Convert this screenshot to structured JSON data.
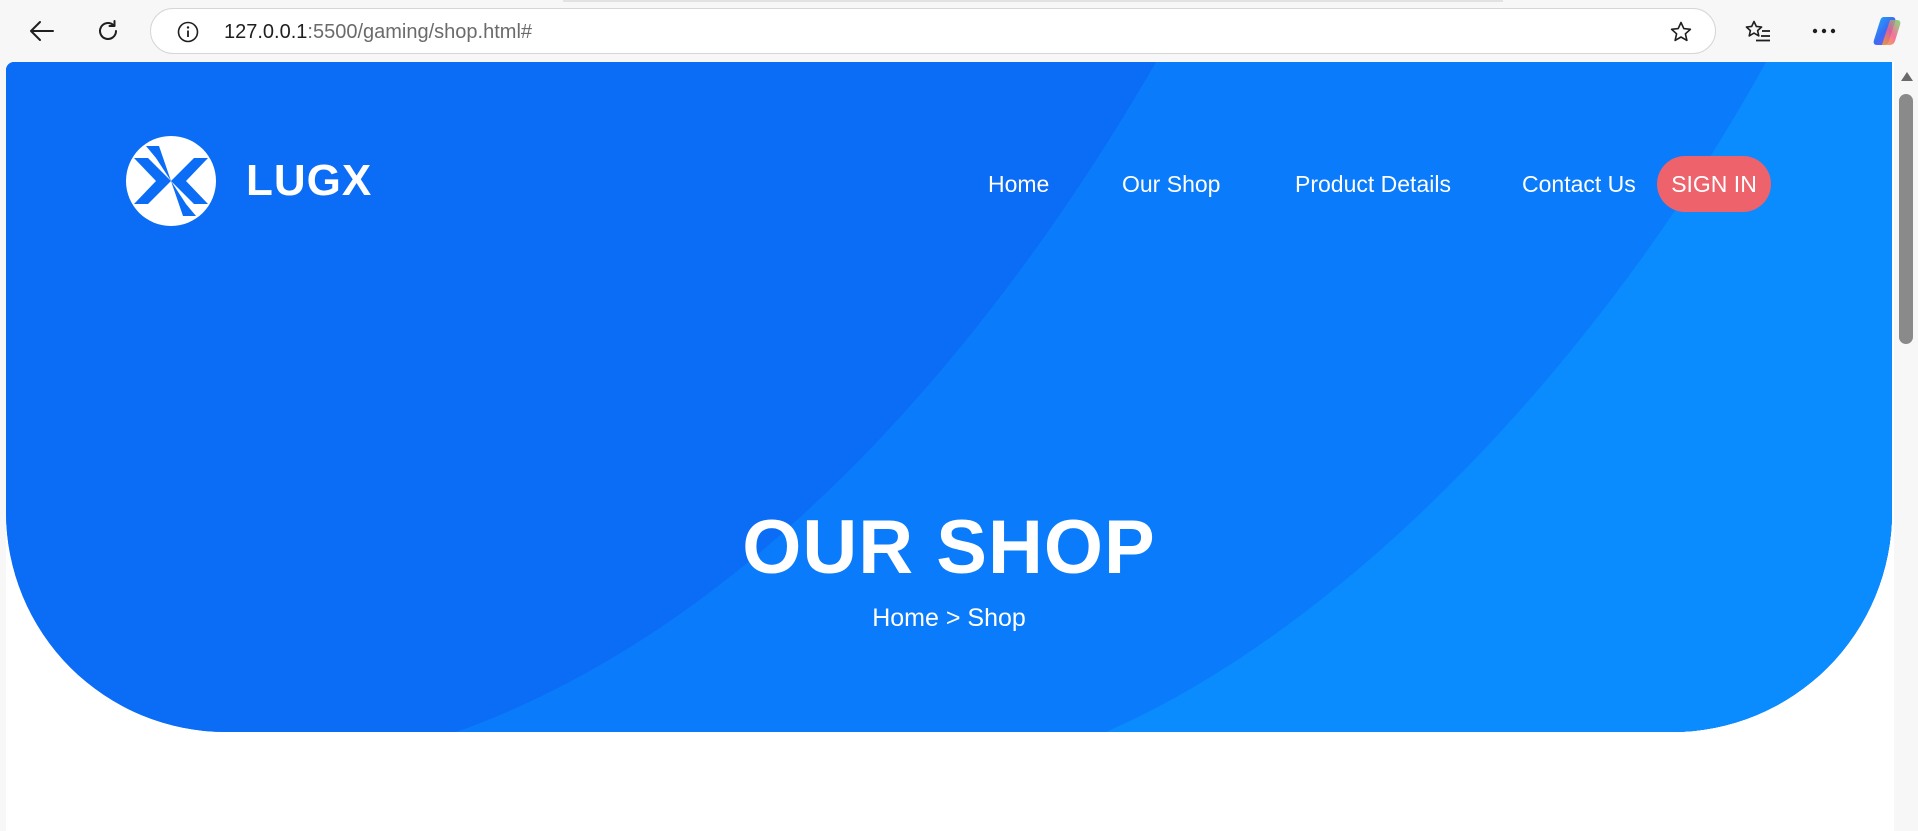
{
  "browser": {
    "url_host": "127.0.0.1",
    "url_path": ":5500/gaming/shop.html#",
    "icons": [
      "back-arrow-icon",
      "reload-icon",
      "site-info-icon",
      "star-icon",
      "favorites-list-icon",
      "more-icon",
      "copilot-icon"
    ]
  },
  "site": {
    "logo_text": "LUGX",
    "nav": {
      "home": "Home",
      "shop": "Our Shop",
      "product": "Product Details",
      "contact": "Contact Us"
    },
    "sign_in": "SIGN IN",
    "hero_title": "OUR SHOP",
    "breadcrumb": {
      "home": "Home",
      "separator": " > ",
      "current": "Shop"
    }
  },
  "colors": {
    "hero_blue": "#0b6cf6",
    "hero_light_blue": "#0a8cff",
    "sign_in_red": "#ee626b",
    "text_white": "#ffffff"
  }
}
